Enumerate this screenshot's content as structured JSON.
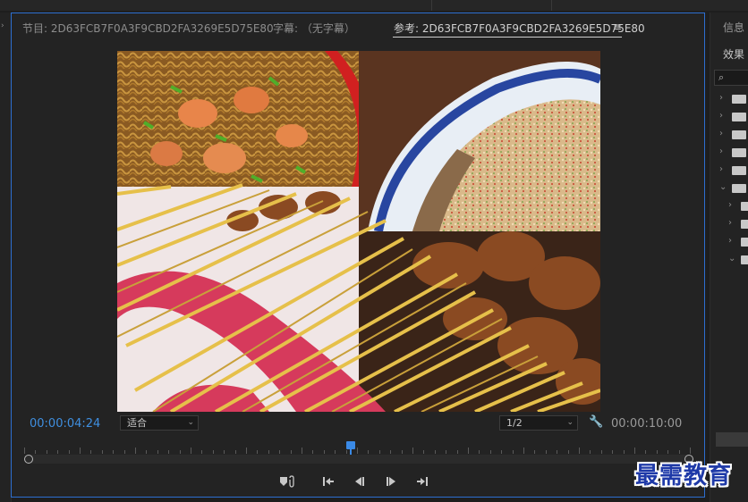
{
  "monitor": {
    "tabs": [
      {
        "label": "节目: 2D63FCB7F0A3F9CBD2FA3269E5D75E80",
        "active": false
      },
      {
        "label": "字幕: （无字幕）",
        "active": false
      },
      {
        "label": "参考: 2D63FCB7F0A3F9CBD2FA3269E5D75E80",
        "active": true
      }
    ],
    "menu_icon": "hamburger-menu-icon",
    "current_timecode": "00:00:04:24",
    "duration_timecode": "00:00:10:00",
    "zoom_select": "适合",
    "resolution_select": "1/2",
    "playhead_fraction": 0.49,
    "transport": {
      "marker": "insert-marker-icon",
      "go_to_in": "go-to-in-icon",
      "step_back": "step-back-icon",
      "step_forward": "step-forward-icon",
      "go_to_out": "go-to-out-icon"
    }
  },
  "right_panel": {
    "tabs": [
      "信息",
      "效果"
    ],
    "search_icon": "search-icon"
  },
  "watermark": "最需教育",
  "colors": {
    "accent": "#2d6fd1",
    "timecode": "#3f8fe0",
    "playhead": "#3a8ae6",
    "background": "#232323"
  }
}
